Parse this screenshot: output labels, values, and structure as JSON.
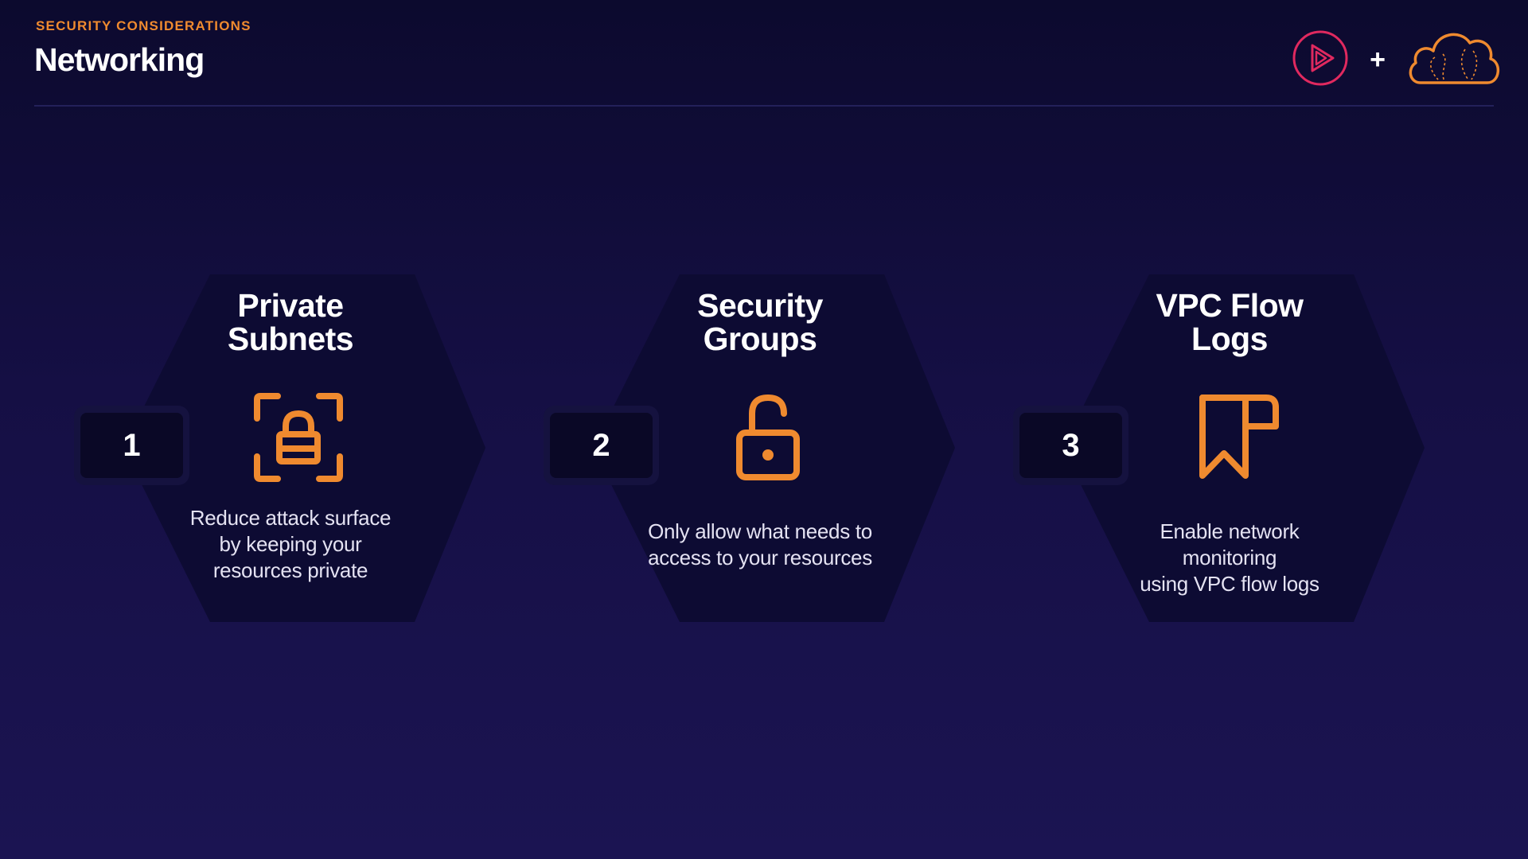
{
  "header": {
    "eyebrow": "SECURITY CONSIDERATIONS",
    "title": "Networking"
  },
  "brand": {
    "plus": "+",
    "icons": [
      "play-logo-icon",
      "cloud-logo-icon"
    ]
  },
  "colors": {
    "accent": "#ef8a2f",
    "brand_pink": "#e0295f",
    "hex_fill": "#0d0b33",
    "background": "#150f44"
  },
  "items": [
    {
      "number": "1",
      "title_line1": "Private",
      "title_line2": "Subnets",
      "desc_line1": "Reduce attack surface",
      "desc_line2": "by keeping your",
      "desc_line3": "resources private",
      "icon": "lock-focus-icon"
    },
    {
      "number": "2",
      "title_line1": "Security",
      "title_line2": "Groups",
      "desc_line1": "Only allow what needs to",
      "desc_line2": "access to your resources",
      "icon": "unlocked-padlock-icon"
    },
    {
      "number": "3",
      "title_line1": "VPC Flow",
      "title_line2": "Logs",
      "desc_line1": "Enable network monitoring",
      "desc_line2": "using VPC flow logs",
      "icon": "bookmark-flag-icon"
    }
  ]
}
